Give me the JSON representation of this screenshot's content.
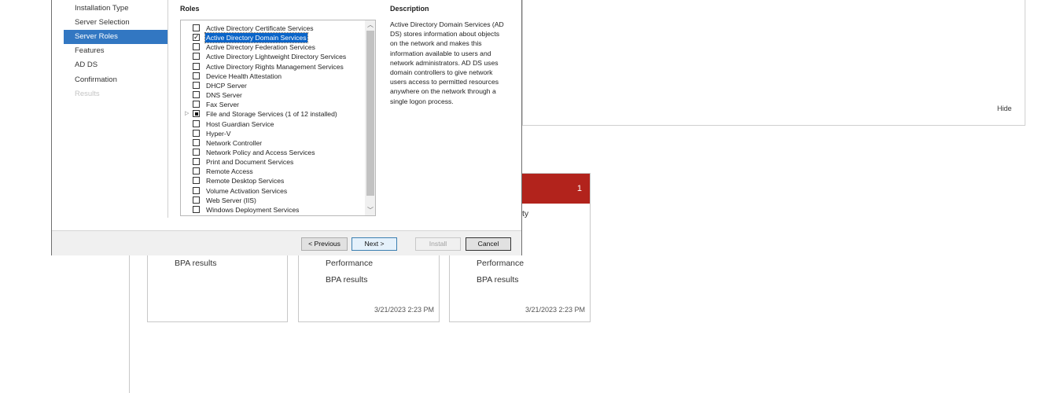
{
  "wizard": {
    "nav_items": [
      {
        "label": "Installation Type",
        "state": "normal"
      },
      {
        "label": "Server Selection",
        "state": "normal"
      },
      {
        "label": "Server Roles",
        "state": "selected"
      },
      {
        "label": "Features",
        "state": "normal"
      },
      {
        "label": "AD DS",
        "state": "normal"
      },
      {
        "label": "Confirmation",
        "state": "normal"
      },
      {
        "label": "Results",
        "state": "disabled"
      }
    ],
    "roles_heading": "Roles",
    "description_heading": "Description",
    "roles": [
      {
        "label": "Active Directory Certificate Services",
        "checked": false
      },
      {
        "label": "Active Directory Domain Services",
        "checked": true,
        "selected": true
      },
      {
        "label": "Active Directory Federation Services",
        "checked": false
      },
      {
        "label": "Active Directory Lightweight Directory Services",
        "checked": false
      },
      {
        "label": "Active Directory Rights Management Services",
        "checked": false
      },
      {
        "label": "Device Health Attestation",
        "checked": false
      },
      {
        "label": "DHCP Server",
        "checked": false
      },
      {
        "label": "DNS Server",
        "checked": false
      },
      {
        "label": "Fax Server",
        "checked": false
      },
      {
        "label": "File and Storage Services (1 of 12 installed)",
        "checked": "partial",
        "expandable": true
      },
      {
        "label": "Host Guardian Service",
        "checked": false
      },
      {
        "label": "Hyper-V",
        "checked": false
      },
      {
        "label": "Network Controller",
        "checked": false
      },
      {
        "label": "Network Policy and Access Services",
        "checked": false
      },
      {
        "label": "Print and Document Services",
        "checked": false
      },
      {
        "label": "Remote Access",
        "checked": false
      },
      {
        "label": "Remote Desktop Services",
        "checked": false
      },
      {
        "label": "Volume Activation Services",
        "checked": false
      },
      {
        "label": "Web Server (IIS)",
        "checked": false
      },
      {
        "label": "Windows Deployment Services",
        "checked": false
      }
    ],
    "description_text": "Active Directory Domain Services (AD DS) stores information about objects on the network and makes this information available to users and network administrators. AD DS uses domain controllers to give network users access to permitted resources anywhere on the network through a single logon process.",
    "buttons": {
      "previous": "< Previous",
      "next": "Next >",
      "install": "Install",
      "cancel": "Cancel"
    }
  },
  "background": {
    "hide_label": "Hide",
    "tile1": {
      "line1": "BPA results"
    },
    "tile2": {
      "line1": "Performance",
      "line2": "BPA results",
      "timestamp": "3/21/2023 2:23 PM"
    },
    "tile3": {
      "count": "1",
      "partial_label": "ty",
      "line1": "Performance",
      "line2": "BPA results",
      "timestamp": "3/21/2023 2:23 PM"
    },
    "alert_color": "#b2231c"
  },
  "colors": {
    "selection_blue": "#3277c2",
    "primary_button_border": "#3c7fb1"
  }
}
